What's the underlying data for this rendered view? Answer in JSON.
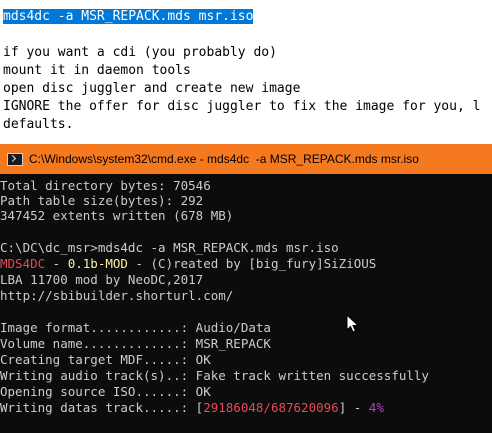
{
  "document": {
    "lines": [
      "mds4dc -a MSR_REPACK.mds msr.iso",
      "if you want a cdi (you probably do)",
      "mount it in daemon tools",
      "open disc juggler and create new image",
      "IGNORE the offer for disc juggler to fix the image for you, l",
      "defaults."
    ]
  },
  "window": {
    "title": "C:\\Windows\\system32\\cmd.exe - mds4dc  -a MSR_REPACK.mds msr.iso",
    "title_color": "#f57a1f"
  },
  "console": {
    "pre": [
      "Total directory bytes: 70546",
      "Path table size(bytes): 292",
      "347452 extents written (678 MB)"
    ],
    "prompt": "C:\\DC\\dc_msr>mds4dc -a MSR_REPACK.mds msr.iso",
    "banner": {
      "name": "MDS4DC",
      "sep": " - ",
      "version": "0.1b-MOD",
      "rest": " - (C)reated by [big_fury]SiZiOUS"
    },
    "lba": "LBA 11700 mod by NeoDC,2017",
    "url": "http://sbibuilder.shorturl.com/",
    "info": [
      "Image format............: Audio/Data",
      "Volume name.............: MSR_REPACK",
      "Creating target MDF.....: OK",
      "Writing audio track(s)..: Fake track written successfully",
      "Opening source ISO......: OK"
    ],
    "progress": {
      "label": "Writing datas track.....: ",
      "open": "[",
      "done": "29186048",
      "slash": "/",
      "total": "687620096",
      "close": "]",
      "dash": " - ",
      "percent": "4%"
    },
    "colors": {
      "text": "#cccccc",
      "red": "#e74856",
      "yellow": "#f9f1a5",
      "purple": "#c239c8"
    }
  },
  "icons": {
    "window_icon": "cmd-icon",
    "pointer": "mouse-cursor-icon"
  }
}
